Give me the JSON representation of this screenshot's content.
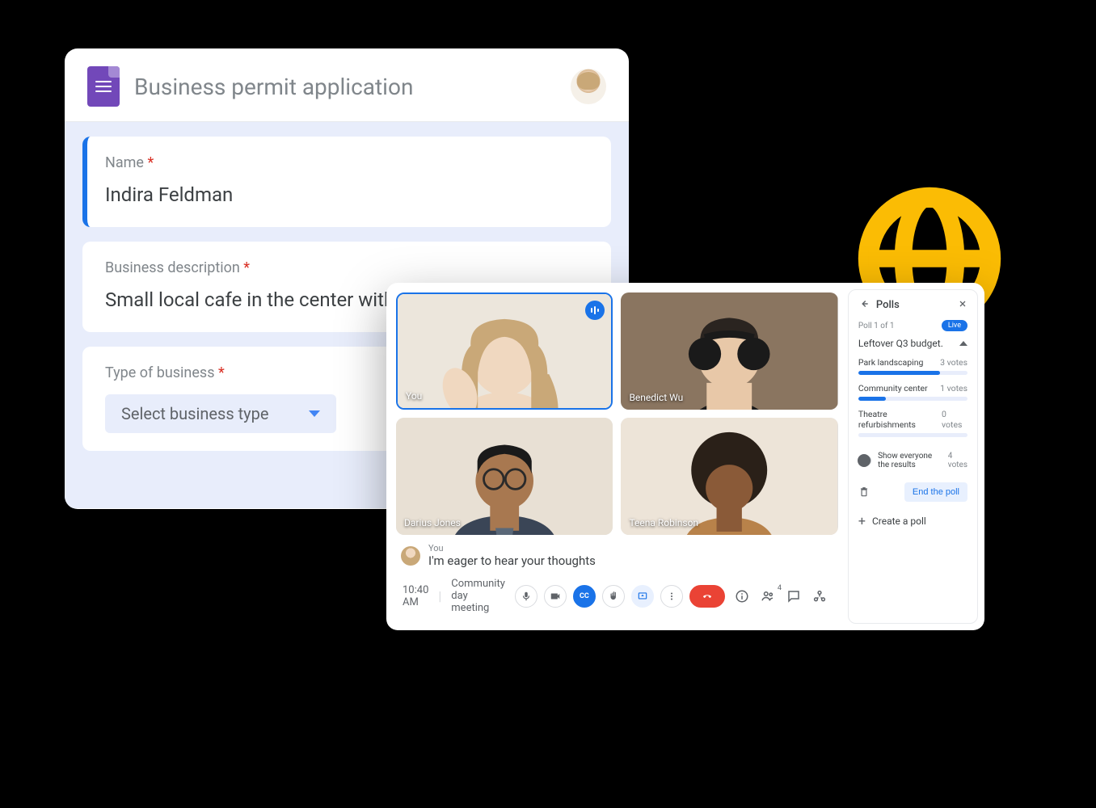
{
  "forms": {
    "title": "Business permit application",
    "q1_label": "Name",
    "q1_value": "Indira Feldman",
    "q2_label": "Business description",
    "q2_value": "Small local cafe in the center with an onsite bakery.",
    "q3_label": "Type of business",
    "q3_select": "Select business type"
  },
  "meet": {
    "tiles": {
      "you": "You",
      "p2": "Benedict Wu",
      "p3": "Darius Jones",
      "p4": "Teena Robinson"
    },
    "caption_who": "You",
    "caption_msg": "I'm eager to hear your thoughts",
    "time": "10:40 AM",
    "meeting_name": "Community day meeting",
    "cc_label": "CC",
    "participant_count": "4"
  },
  "polls": {
    "title": "Polls",
    "meta": "Poll 1 of 1",
    "live": "Live",
    "question": "Leftover Q3 budget.",
    "opt1_label": "Park landscaping",
    "opt1_votes": "3 votes",
    "opt1_pct": 75,
    "opt2_label": "Community center",
    "opt2_votes": "1 votes",
    "opt2_pct": 25,
    "opt3_label": "Theatre refurbishments",
    "opt3_votes": "0 votes",
    "opt3_pct": 0,
    "show_label": "Show everyone the results",
    "total_votes": "4 votes",
    "end_label": "End the poll",
    "create_label": "Create a poll"
  }
}
